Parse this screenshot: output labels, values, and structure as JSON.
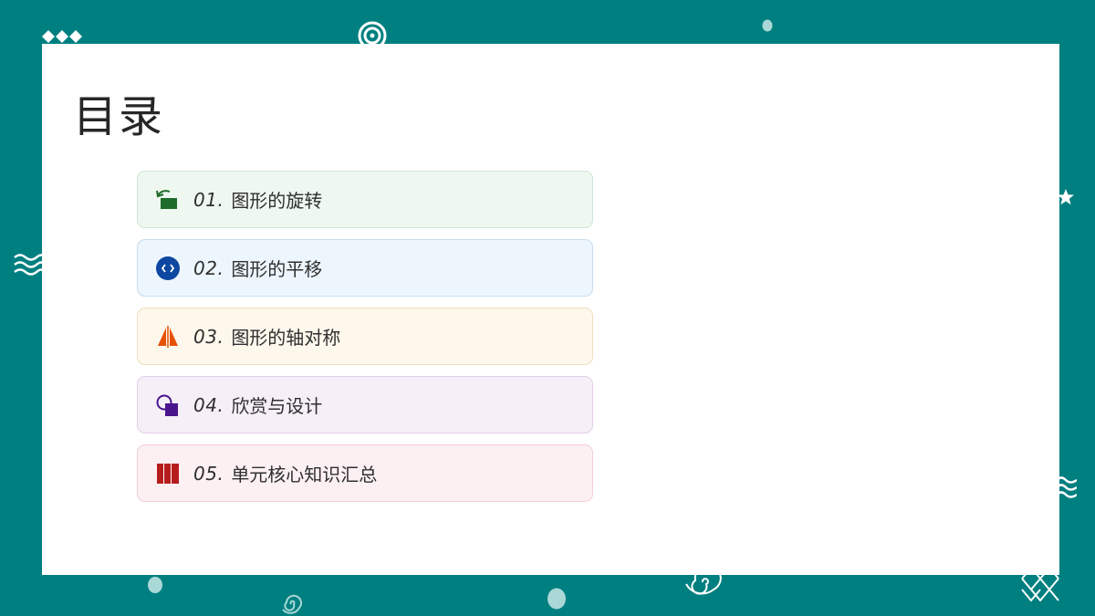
{
  "page": {
    "title": "目录",
    "background_color": "#007f80"
  },
  "toc": [
    {
      "num": "01.",
      "label": "图形的旋转",
      "icon": "rotate-icon",
      "bg": "#eef8f0",
      "border": "#cfe6d4",
      "icon_color": "#1e6b2a"
    },
    {
      "num": "02.",
      "label": "图形的平移",
      "icon": "translate-icon",
      "bg": "#edf6fd",
      "border": "#c6ddf0",
      "icon_color": "#0d47a1"
    },
    {
      "num": "03.",
      "label": "图形的轴对称",
      "icon": "axial-symmetry-icon",
      "bg": "#fdf7ec",
      "border": "#f0dfbf",
      "icon_color": "#e65100"
    },
    {
      "num": "04.",
      "label": "欣赏与设计",
      "icon": "shapes-design-icon",
      "bg": "#f6eff8",
      "border": "#e2cfe8",
      "icon_color": "#4a148c"
    },
    {
      "num": "05.",
      "label": "单元核心知识汇总",
      "icon": "books-icon",
      "bg": "#fdf0f3",
      "border": "#f2cfd7",
      "icon_color": "#b71c1c"
    }
  ]
}
